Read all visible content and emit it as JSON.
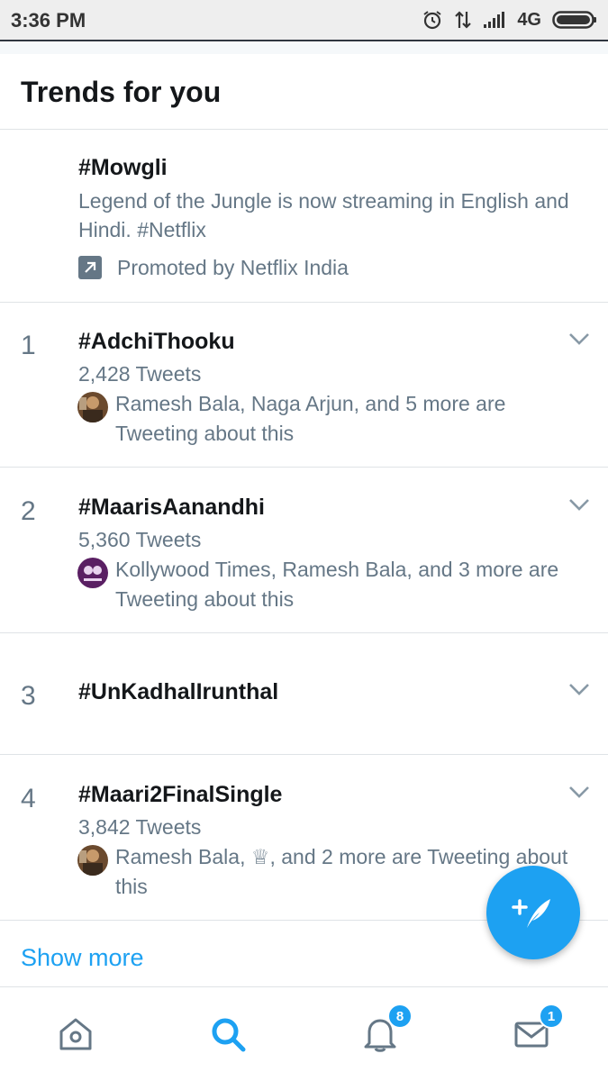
{
  "status_bar": {
    "time": "3:36 PM",
    "network": "4G",
    "icons": [
      "alarm-icon",
      "data-arrows-icon",
      "signal-icon",
      "battery-icon"
    ]
  },
  "header": {
    "title": "Trends for you"
  },
  "promoted": {
    "name": "#Mowgli",
    "description": "Legend of the Jungle is now streaming in English and Hindi. #Netflix",
    "promoted_label": "Promoted by Netflix India"
  },
  "trends": [
    {
      "rank": "1",
      "name": "#AdchiThooku",
      "tweets": "2,428 Tweets",
      "context": "Ramesh Bala, Naga Arjun, and 5 more are Tweeting about this"
    },
    {
      "rank": "2",
      "name": "#MaarisAanandhi",
      "tweets": "5,360 Tweets",
      "context": "Kollywood Times, Ramesh Bala, and 3 more are Tweeting about this"
    },
    {
      "rank": "3",
      "name": "#UnKadhalIrunthal"
    },
    {
      "rank": "4",
      "name": "#Maari2FinalSingle",
      "tweets": "3,842 Tweets",
      "context": "Ramesh Bala, ♕, and 2 more are Tweeting about this"
    }
  ],
  "show_more": "Show more",
  "bottom_nav": {
    "notifications_badge": "8",
    "messages_badge": "1"
  },
  "colors": {
    "accent": "#1da1f2",
    "secondary_text": "#657786",
    "primary_text": "#14171a",
    "divider": "#dfe3e6"
  }
}
